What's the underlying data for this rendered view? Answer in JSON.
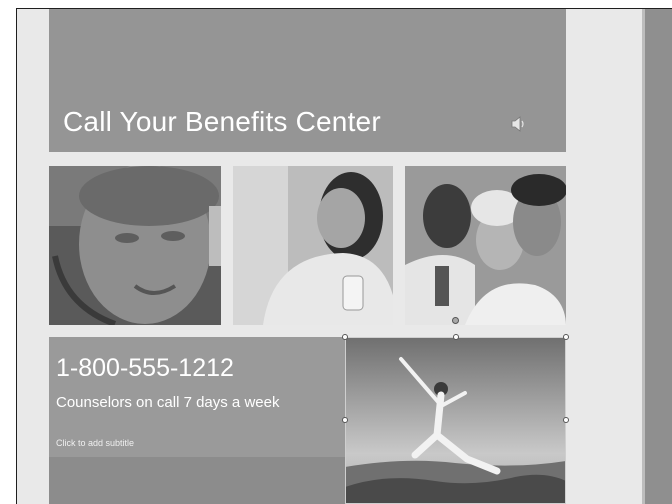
{
  "slide": {
    "title": "Call Your Benefits Center",
    "phone": "1-800-555-1212",
    "counselors": "Counselors on call 7 days a week",
    "subtitle_placeholder": "Click to add subtitle",
    "icons": [
      "speaker-icon"
    ]
  },
  "colors": {
    "background": "#e9e9e9",
    "title_band": "#959595",
    "info_panel": "#9a9a9a",
    "text": "#ffffff"
  }
}
